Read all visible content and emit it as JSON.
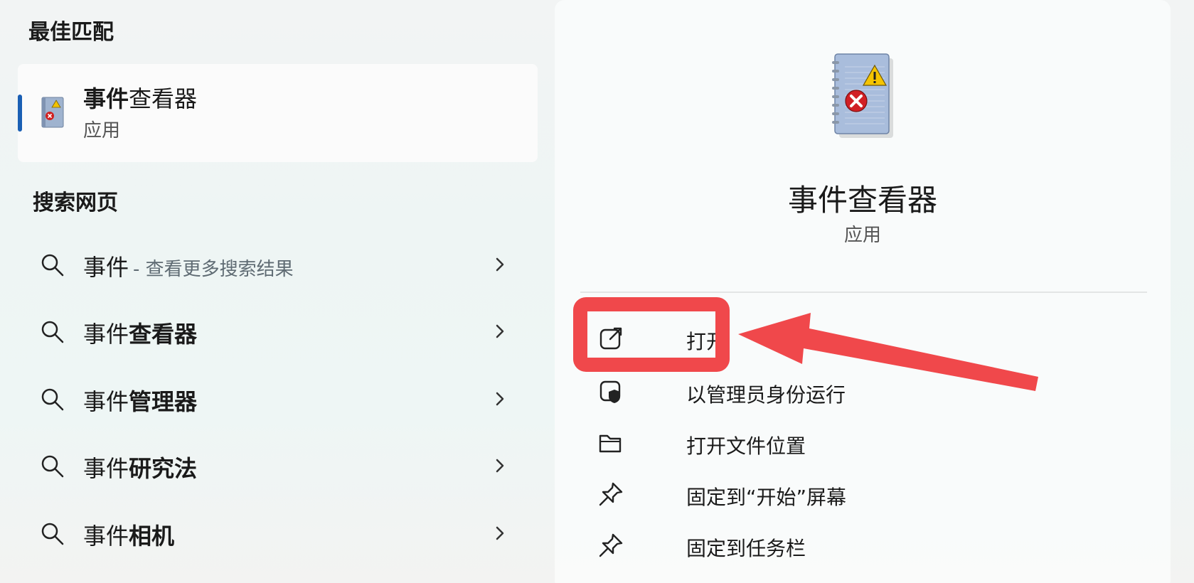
{
  "left": {
    "best_match": {
      "heading": "最佳匹配",
      "title_bold": "事件",
      "title_rest": "查看器",
      "subtitle": "应用"
    },
    "web": {
      "heading": "搜索网页",
      "items": [
        {
          "plain": "事件",
          "bold": "",
          "hint": "- 查看更多搜索结果"
        },
        {
          "plain": "事件",
          "bold": "查看器",
          "hint": ""
        },
        {
          "plain": "事件",
          "bold": "管理器",
          "hint": ""
        },
        {
          "plain": "事件",
          "bold": "研究法",
          "hint": ""
        },
        {
          "plain": "事件",
          "bold": "相机",
          "hint": ""
        }
      ]
    }
  },
  "right": {
    "app_title": "事件查看器",
    "app_subtitle": "应用",
    "actions": [
      {
        "label": "打开",
        "icon": "open-external-icon"
      },
      {
        "label": "以管理员身份运行",
        "icon": "shield-admin-icon"
      },
      {
        "label": "打开文件位置",
        "icon": "folder-icon"
      },
      {
        "label": "固定到“开始”屏幕",
        "icon": "pin-icon"
      },
      {
        "label": "固定到任务栏",
        "icon": "pin-icon"
      }
    ]
  },
  "colors": {
    "accent": "#1a5fb4",
    "annotation_red": "#f0484b"
  }
}
